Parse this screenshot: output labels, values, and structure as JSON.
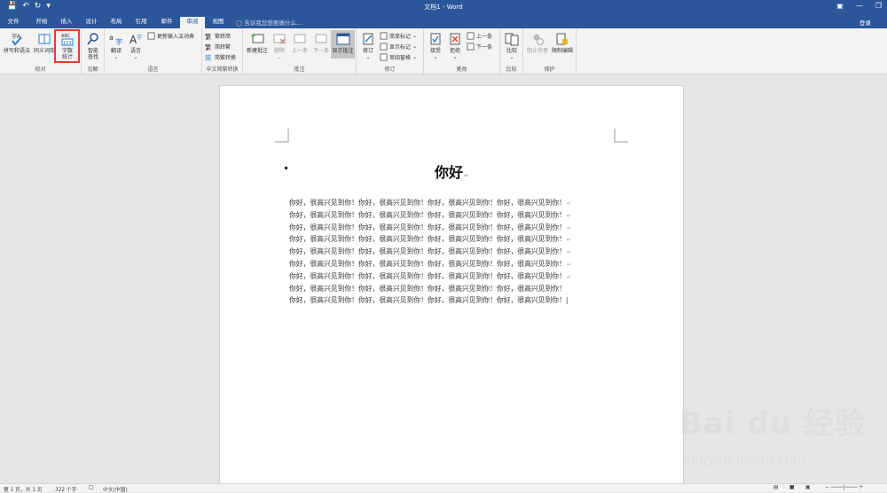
{
  "titlebar": {
    "title": "文档1 - Word"
  },
  "qat": {
    "save_icon": "save-icon",
    "undo_icon": "undo-icon",
    "redo_icon": "redo-icon"
  },
  "tabs": [
    {
      "label": "文件"
    },
    {
      "label": "开始"
    },
    {
      "label": "插入"
    },
    {
      "label": "设计"
    },
    {
      "label": "布局"
    },
    {
      "label": "引用"
    },
    {
      "label": "邮件"
    },
    {
      "label": "审阅"
    },
    {
      "label": "视图"
    }
  ],
  "active_tab": "审阅",
  "tellme": {
    "placeholder": "告诉我您想要做什么..."
  },
  "account": {
    "login": "登录"
  },
  "ribbon": {
    "proofing": {
      "label": "校对",
      "spelling": "拼写和语法",
      "thesaurus": "同义词库",
      "wordcount_line1": "字数",
      "wordcount_line2": "统计",
      "wordcount_icon_top": "ABC",
      "wordcount_icon_bottom": "123"
    },
    "insights": {
      "label": "见解",
      "smart_lookup_line1": "智能",
      "smart_lookup_line2": "查找"
    },
    "language": {
      "label": "语言",
      "translate": "翻译",
      "language": "语言",
      "update_ime": "更新输入法词典"
    },
    "chinese_conversion": {
      "label": "中文简繁转换",
      "to_simplified": "繁转简",
      "to_traditional": "简转繁",
      "conversion": "简繁转换"
    },
    "comments": {
      "label": "批注",
      "new": "新建批注",
      "delete": "删除",
      "previous": "上一条",
      "next": "下一条",
      "show": "显示批注"
    },
    "tracking": {
      "label": "修订",
      "track_changes": "修订",
      "simple_markup": "简单标记",
      "show_markup": "显示标记",
      "review_pane": "审阅窗格"
    },
    "changes": {
      "label": "更改",
      "accept": "接受",
      "reject": "拒绝",
      "previous": "上一条",
      "next": "下一条"
    },
    "compare": {
      "label": "比较",
      "compare": "比较"
    },
    "protect": {
      "label": "保护",
      "block_authors": "阻止作者",
      "restrict_editing": "限制编辑"
    }
  },
  "document": {
    "heading": "你好",
    "body_line": "你好，很高兴见到你！你好，很高兴见到你！你好，很高兴见到你！你好，很高兴见到你！",
    "line_count": 8,
    "last_line": "你好，很高兴见到你！你好，很高兴见到你！你好，很高兴见到你！你好，很高兴见到你！"
  },
  "statusbar": {
    "page": "第 1 页，共 1 页",
    "words": "322 个字",
    "language": "中文(中国)"
  },
  "watermark": {
    "brand": "Bai du 经验",
    "site": "jingyan.baidu.com"
  }
}
